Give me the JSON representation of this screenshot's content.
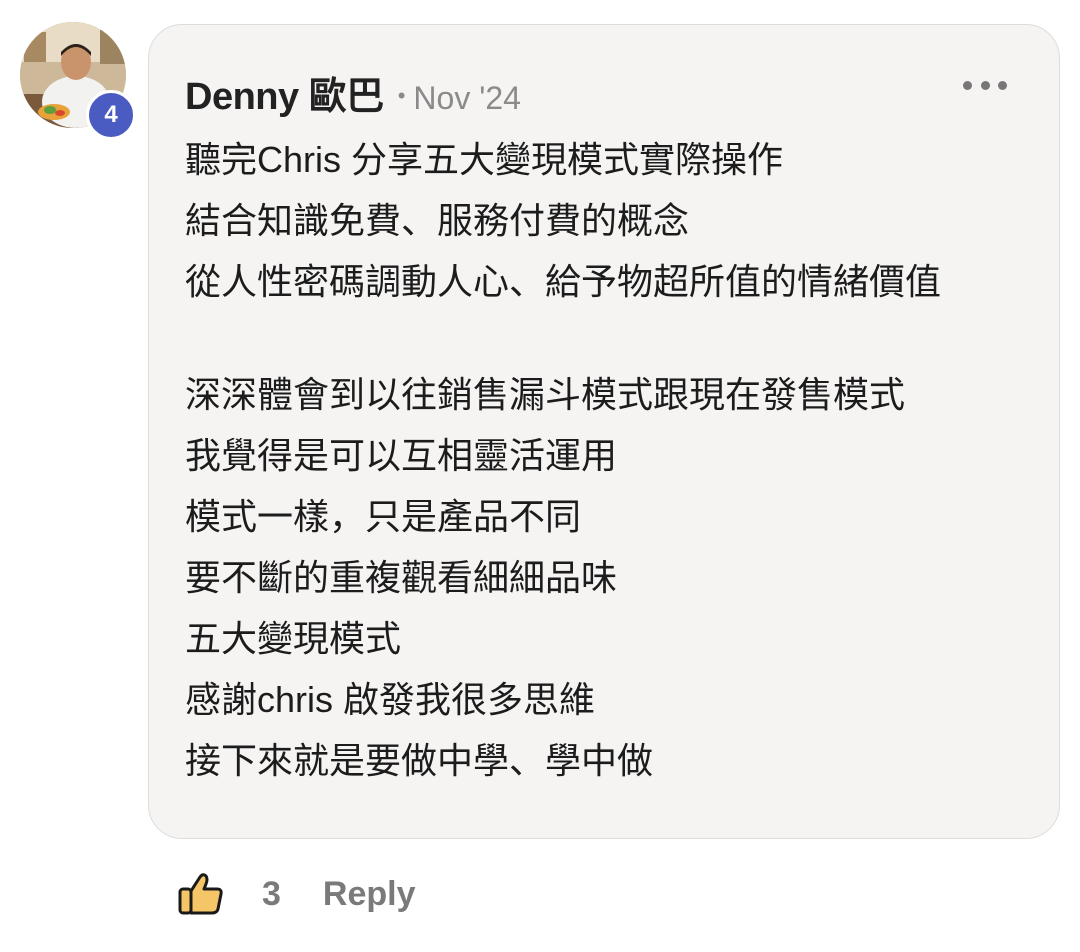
{
  "comment": {
    "author": {
      "name": "Denny 歐巴",
      "level_badge": "4",
      "badge_color": "#4a5bc2"
    },
    "separator": "•",
    "date": "Nov '24",
    "more_icon": "more-horizontal-icon",
    "paragraphs": [
      [
        "聽完Chris 分享五大變現模式實際操作",
        "結合知識免費、服務付費的概念",
        "從人性密碼調動人心、給予物超所值的情緒價值"
      ],
      [
        "深深體會到以往銷售漏斗模式跟現在發售模式",
        "我覺得是可以互相靈活運用",
        "模式一樣，只是產品不同",
        "要不斷的重複觀看細細品味",
        "五大變現模式",
        "感謝chris 啟發我很多思維",
        "接下來就是要做中學、學中做"
      ]
    ]
  },
  "actions": {
    "like_icon": "thumbs-up-icon",
    "like_count": "3",
    "reply_label": "Reply"
  },
  "colors": {
    "bubble_background": "#f5f4f3",
    "secondary_text": "#7a7a7a",
    "like_icon_fill": "#f5c667"
  }
}
